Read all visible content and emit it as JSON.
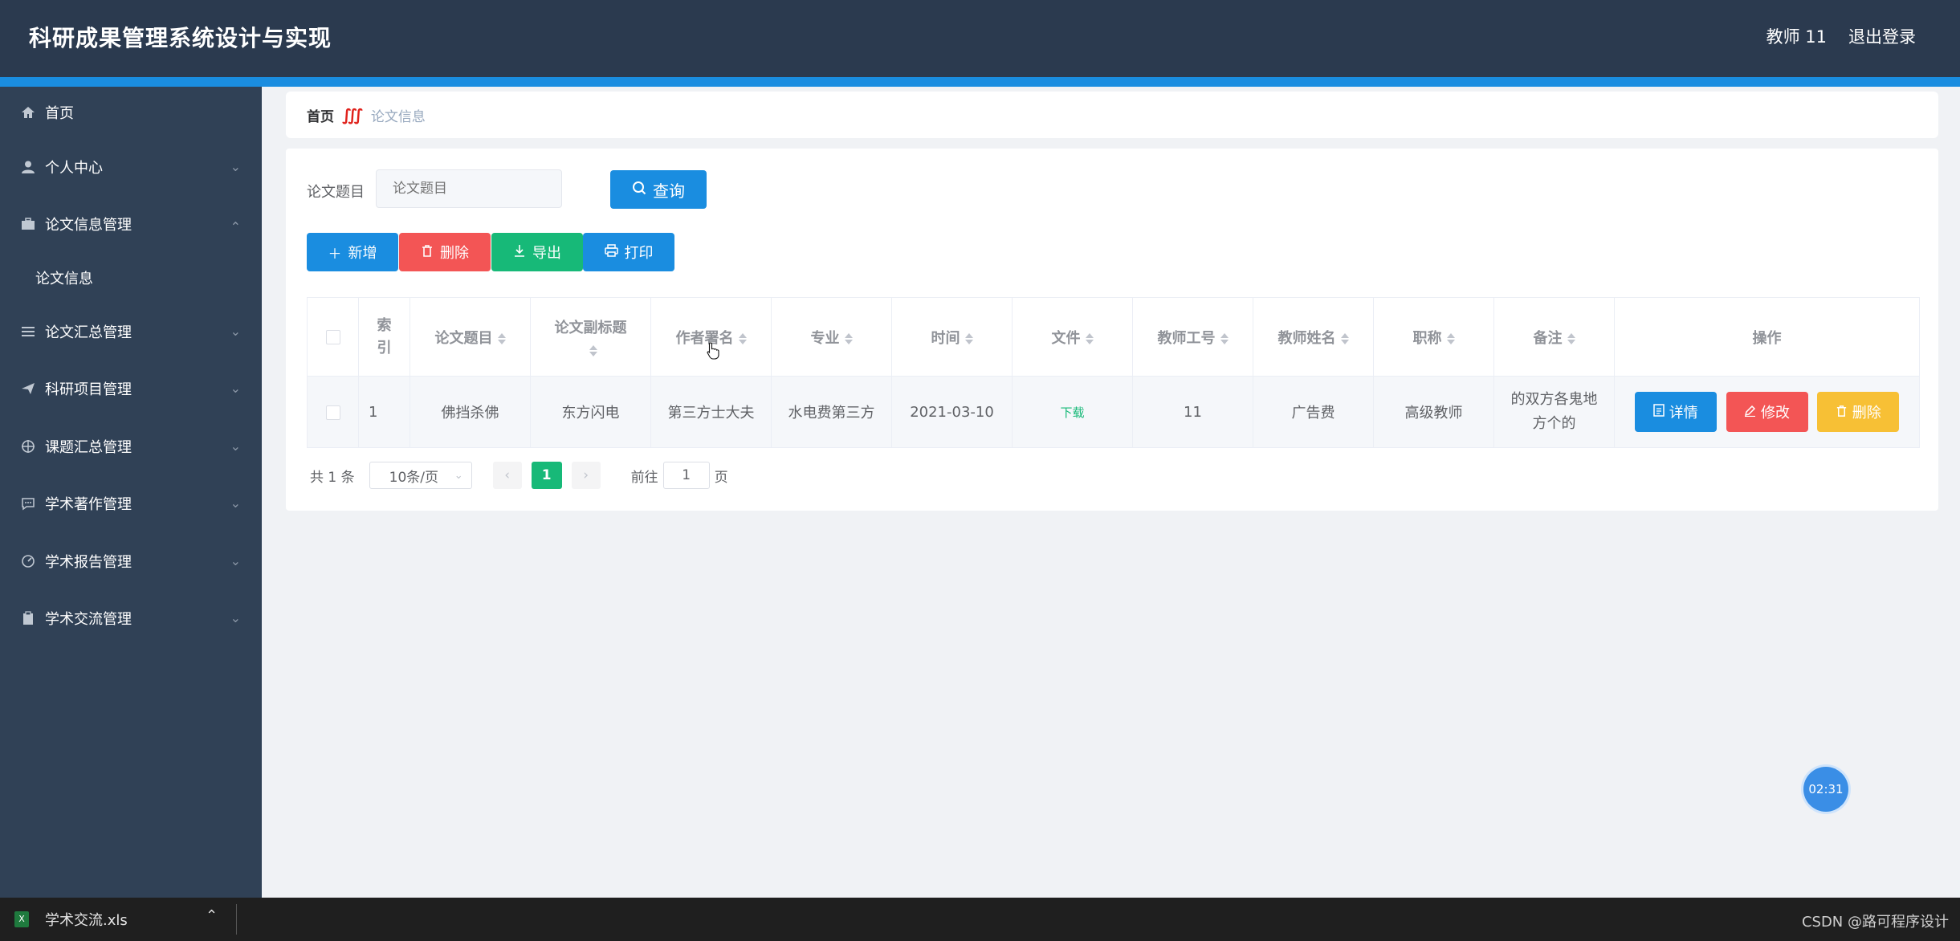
{
  "header": {
    "title": "科研成果管理系统设计与实现",
    "user": "教师 11",
    "logout": "退出登录"
  },
  "sidebar": {
    "items": [
      {
        "label": "首页",
        "icon": "home-icon"
      },
      {
        "label": "个人中心",
        "icon": "user-icon"
      },
      {
        "label": "论文信息管理",
        "icon": "briefcase-icon",
        "expanded": true
      },
      {
        "label": "论文汇总管理",
        "icon": "list-icon"
      },
      {
        "label": "科研项目管理",
        "icon": "send-icon"
      },
      {
        "label": "课题汇总管理",
        "icon": "target-icon"
      },
      {
        "label": "学术著作管理",
        "icon": "chat-icon"
      },
      {
        "label": "学术报告管理",
        "icon": "dashboard-icon"
      },
      {
        "label": "学术交流管理",
        "icon": "clipboard-icon"
      }
    ],
    "subitem": "论文信息"
  },
  "breadcrumb": {
    "home": "首页",
    "separator": "∭",
    "current": "论文信息"
  },
  "search": {
    "label": "论文题目",
    "placeholder": "论文题目",
    "button": "查询"
  },
  "toolbar": {
    "add": "新增",
    "delete": "删除",
    "export": "导出",
    "print": "打印"
  },
  "table": {
    "headers": [
      "索引",
      "论文题目",
      "论文副标题",
      "作者署名",
      "专业",
      "时间",
      "文件",
      "教师工号",
      "教师姓名",
      "职称",
      "备注",
      "操作"
    ],
    "rows": [
      {
        "index": "1",
        "title": "佛挡杀佛",
        "subtitle": "东方闪电",
        "author": "第三方士大夫",
        "major": "水电费第三方",
        "time": "2021-03-10",
        "file": "下载",
        "teacher_id": "11",
        "teacher_name": "广告费",
        "rank": "高级教师",
        "remark": "的双方各鬼地方个的"
      }
    ],
    "actions": {
      "detail": "详情",
      "edit": "修改",
      "delete": "删除"
    }
  },
  "pagination": {
    "total": "共 1 条",
    "page_size": "10条/页",
    "current": "1",
    "goto_label": "前往",
    "goto_value": "1",
    "page_suffix": "页"
  },
  "download_bar": {
    "file": "学术交流.xls"
  },
  "timer": "02:31",
  "watermark": "CSDN @路可程序设计",
  "colors": {
    "header_bg": "#2b3a4f",
    "sidebar_bg": "#304156",
    "primary": "#1a8de0",
    "danger": "#f35555",
    "success": "#17b978",
    "warning": "#f7c035"
  }
}
